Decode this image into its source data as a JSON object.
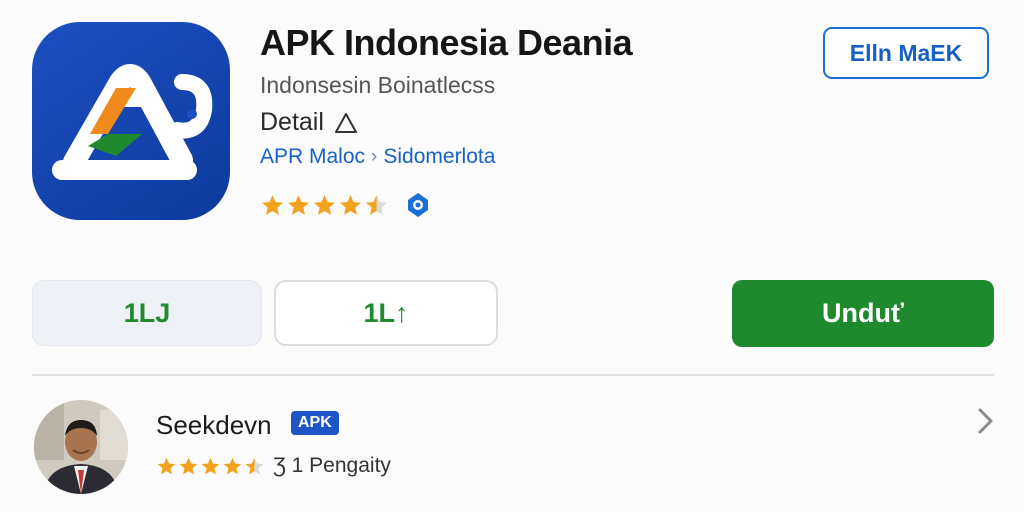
{
  "app": {
    "title": "APK Indonesia Deania",
    "subtitle": "Indonsesin Boinatlecss",
    "detail_label": "Detail",
    "breadcrumb": [
      "APR Maloc",
      "Sidomerlota"
    ],
    "rating_stars": 4.5,
    "icon": "apk-logo-icon"
  },
  "header": {
    "top_button_label": "Elln MaEK"
  },
  "actions": {
    "button_1_glyph": "1LJ",
    "button_2_glyph": "1L↑",
    "download_label": "Unduť"
  },
  "developer": {
    "name": "Seekdevn",
    "badge": "APK",
    "rating_stars": 4.5,
    "rating_text": "Ʒ 1 Pengaity"
  },
  "colors": {
    "accent_blue": "#1a6fd4",
    "download_green": "#1e8a2d",
    "star_gold": "#f2a21c",
    "icon_blue": "#1d4fc2"
  }
}
